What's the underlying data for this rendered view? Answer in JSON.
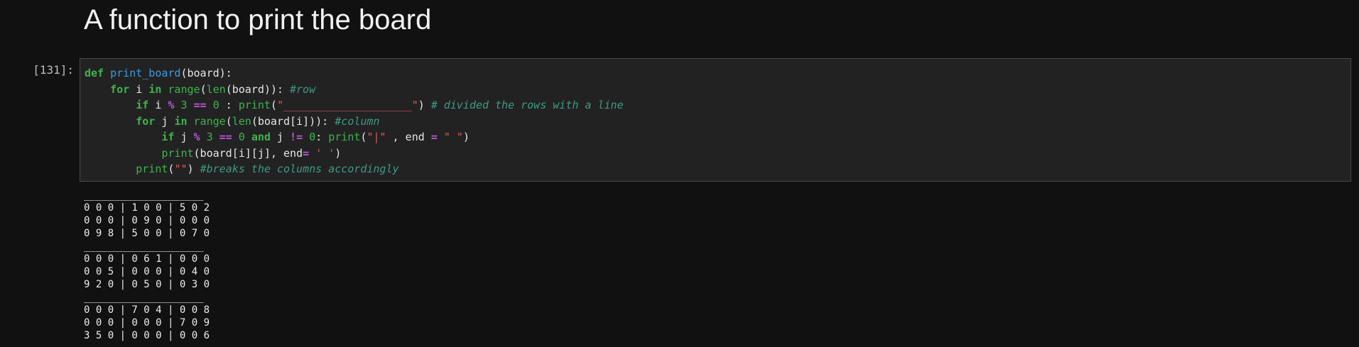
{
  "heading": "A function to print the board",
  "cell": {
    "prompt": "[131]:",
    "code": {
      "l1": {
        "kw": "def",
        "sp": " ",
        "fn": "print_board",
        "rest": "(board):"
      },
      "l2": {
        "indent": "    ",
        "kw1": "for",
        "t1": " i ",
        "kw2": "in",
        "t2": " ",
        "bi1": "range",
        "t3": "(",
        "bi2": "len",
        "t4": "(board)): ",
        "cm": "#row"
      },
      "l3": {
        "indent": "        ",
        "kw": "if",
        "t1": " i ",
        "op1": "%",
        "t2": " ",
        "n1": "3",
        "t3": " ",
        "op2": "==",
        "t4": " ",
        "n2": "0",
        "t5": " : ",
        "bi": "print",
        "t6": "(",
        "str": "\"____________________\"",
        "t7": ") ",
        "cm": "# divided the rows with a line"
      },
      "l4": {
        "indent": "        ",
        "kw1": "for",
        "t1": " j ",
        "kw2": "in",
        "t2": " ",
        "bi1": "range",
        "t3": "(",
        "bi2": "len",
        "t4": "(board[i])): ",
        "cm": "#column"
      },
      "l5": {
        "indent": "            ",
        "kw1": "if",
        "t1": " j ",
        "op1": "%",
        "t2": " ",
        "n1": "3",
        "t3": " ",
        "op2": "==",
        "t4": " ",
        "n2": "0",
        "t5": " ",
        "kw2": "and",
        "t6": " j ",
        "op3": "!=",
        "t7": " ",
        "n3": "0",
        "t8": ": ",
        "bi": "print",
        "t9": "(",
        "str1": "\"|\"",
        "t10": " , end ",
        "op4": "=",
        "t11": " ",
        "str2": "\" \"",
        "t12": ")"
      },
      "l6": {
        "indent": "            ",
        "bi": "print",
        "t1": "(board[i][j], end",
        "op": "=",
        "t2": " ",
        "str": "' '",
        "t3": ")"
      },
      "l7": {
        "indent": "        ",
        "bi": "print",
        "t1": "(",
        "str": "\"\"",
        "t2": ") ",
        "cm": "#breaks the columns accordingly"
      }
    }
  },
  "output": {
    "sep": "____________________",
    "rows": [
      "0 0 0 | 1 0 0 | 5 0 2",
      "0 0 0 | 0 9 0 | 0 0 0",
      "0 9 8 | 5 0 0 | 0 7 0",
      "0 0 0 | 0 6 1 | 0 0 0",
      "0 0 5 | 0 0 0 | 0 4 0",
      "9 2 0 | 0 5 0 | 0 3 0",
      "0 0 0 | 7 0 4 | 0 0 8",
      "0 0 0 | 0 0 0 | 7 0 9",
      "3 5 0 | 0 0 0 | 0 0 6"
    ]
  }
}
